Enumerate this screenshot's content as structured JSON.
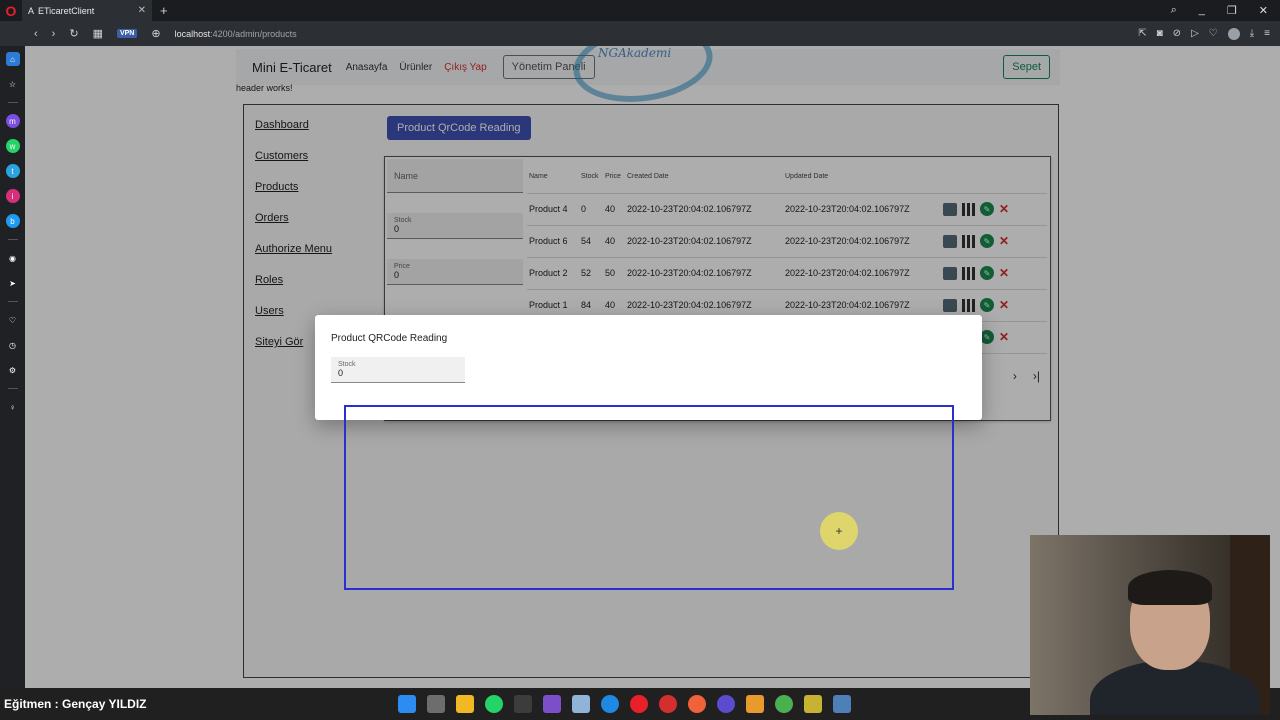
{
  "browser": {
    "tab_title": "ETicaretClient",
    "url_host": "localhost",
    "url_rest": ":4200/admin/products",
    "vpn_label": "VPN"
  },
  "navbar": {
    "brand": "Mini E-Ticaret",
    "links": [
      "Anasayfa",
      "Ürünler",
      "Çıkış Yap"
    ],
    "admin_button": "Yönetim Paneli",
    "cart_button": "Sepet"
  },
  "header_works": "header works!",
  "watermark": "NGAkademi",
  "admin_menu": [
    "Dashboard",
    "Customers",
    "Products",
    "Orders",
    "Authorize Menu",
    "Roles",
    "Users",
    "Siteyi Gör"
  ],
  "qr_button": "Product QrCode Reading",
  "create_form": {
    "name_placeholder": "Name",
    "stock_label": "Stock",
    "stock_value": "0",
    "price_label": "Price",
    "price_value": "0"
  },
  "table": {
    "headers": [
      "Name",
      "Stock",
      "Price",
      "Created Date",
      "Updated Date"
    ],
    "rows": [
      {
        "name": "Product 4",
        "stock": "0",
        "price": "40",
        "created": "2022-10-23T20:04:02.106797Z",
        "updated": "2022-10-23T20:04:02.106797Z"
      },
      {
        "name": "Product 6",
        "stock": "54",
        "price": "40",
        "created": "2022-10-23T20:04:02.106797Z",
        "updated": "2022-10-23T20:04:02.106797Z"
      },
      {
        "name": "Product 2",
        "stock": "52",
        "price": "50",
        "created": "2022-10-23T20:04:02.106797Z",
        "updated": "2022-10-23T20:04:02.106797Z"
      },
      {
        "name": "Product 1",
        "stock": "84",
        "price": "40",
        "created": "2022-10-23T20:04:02.106797Z",
        "updated": "2022-10-23T20:04:02.106797Z"
      }
    ]
  },
  "dialog": {
    "title": "Product QRCode Reading",
    "stock_label": "Stock",
    "stock_value": "0"
  },
  "taskbar": {
    "instructor": "Eğitmen : Gençay YILDIZ"
  }
}
